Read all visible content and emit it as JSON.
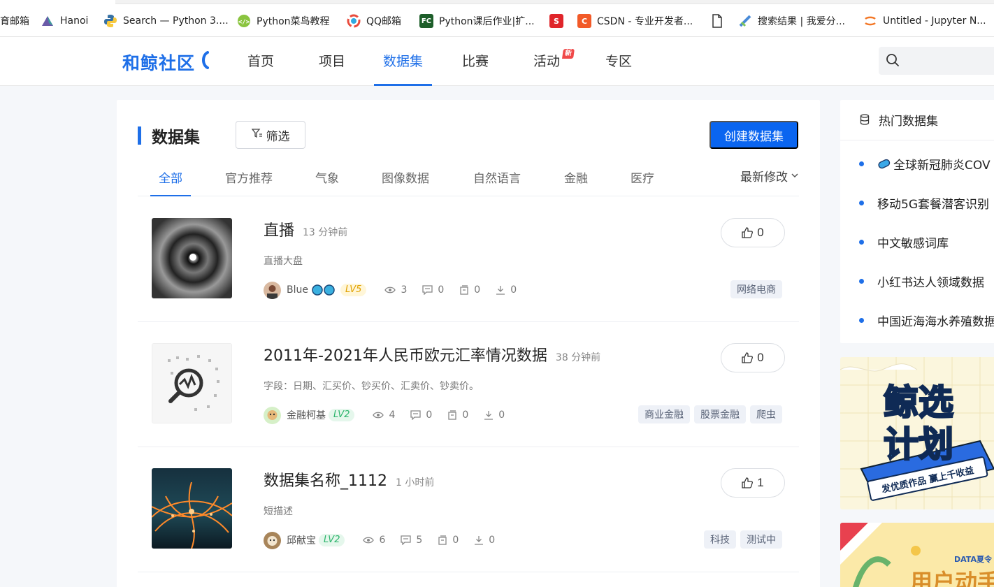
{
  "bookmarks": [
    {
      "label": "育邮箱",
      "icon": "mail-icon"
    },
    {
      "label": "Hanoi",
      "icon": "hanoi-icon"
    },
    {
      "label": "Search — Python 3....",
      "icon": "python-icon"
    },
    {
      "label": "Python菜鸟教程",
      "icon": "runoob-icon"
    },
    {
      "label": "QQ邮箱",
      "icon": "qqmail-icon"
    },
    {
      "label": "Python课后作业|扩...",
      "icon": "fc-icon"
    },
    {
      "label": "",
      "icon": "s-icon"
    },
    {
      "label": "CSDN - 专业开发者...",
      "icon": "csdn-icon"
    },
    {
      "label": "",
      "icon": "page-icon"
    },
    {
      "label": "搜索结果 | 我爱分...",
      "icon": "search-result-icon"
    },
    {
      "label": "Untitled - Jupyter N...",
      "icon": "jupyter-icon"
    }
  ],
  "header": {
    "logo": "和鲸社区",
    "nav": [
      "首页",
      "项目",
      "数据集",
      "比赛",
      "活动",
      "专区"
    ],
    "new_badge": "新",
    "search_placeholder": ""
  },
  "main": {
    "title": "数据集",
    "filter_label": "筛选",
    "create_label": "创建数据集",
    "tabs": [
      "全部",
      "官方推荐",
      "气象",
      "图像数据",
      "自然语言",
      "金融",
      "医疗"
    ],
    "sort_label": "最新修改",
    "rows": [
      {
        "title": "直播",
        "time": "13 分钟前",
        "desc": "直播大盘",
        "user": "Blue",
        "level": "LV5",
        "views": "3",
        "comments": "0",
        "forks": "0",
        "downloads": "0",
        "likes": "0",
        "tags": [
          "网络电商"
        ]
      },
      {
        "title": "2011年-2021年人民币欧元汇率情况数据",
        "time": "38 分钟前",
        "desc": "字段：日期、汇买价、钞买价、汇卖价、钞卖价。",
        "user": "金融柯基",
        "level": "LV2",
        "views": "4",
        "comments": "0",
        "forks": "0",
        "downloads": "0",
        "likes": "0",
        "tags": [
          "商业金融",
          "股票金融",
          "爬虫"
        ]
      },
      {
        "title": "数据集名称_1112",
        "time": "1 小时前",
        "desc": "短描述",
        "user": "邱献宝",
        "level": "LV2",
        "views": "6",
        "comments": "5",
        "forks": "0",
        "downloads": "0",
        "likes": "1",
        "tags": [
          "科技",
          "测试中"
        ]
      }
    ]
  },
  "sidebar": {
    "hot_title": "热门数据集",
    "hot_items": [
      "全球新冠肺炎COV",
      "移动5G套餐潜客识别",
      "中文敏感词库",
      "小红书达人领域数据",
      "中国近海海水养殖数据"
    ],
    "banner1": {
      "line1": "鲸选",
      "line2": "计划",
      "slogan": "发优质作品 赢上千收益"
    },
    "banner2": {
      "brand": "DATA夏令",
      "headline": "用户动手"
    }
  },
  "colors": {
    "accent": "#1e6fe8",
    "button": "#0a65f0",
    "badge": "#f04848"
  }
}
